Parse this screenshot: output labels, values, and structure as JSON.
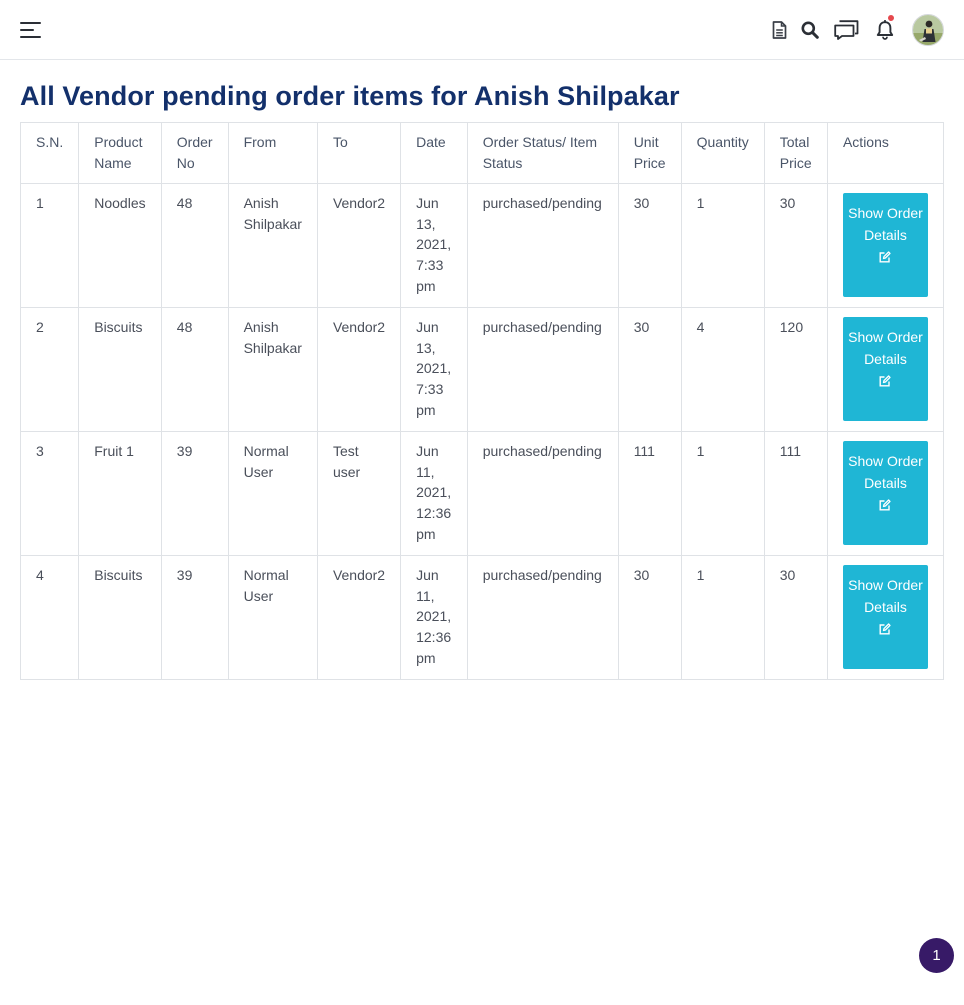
{
  "header": {
    "icons": [
      "menu-icon",
      "document-icon",
      "search-icon",
      "chat-icon",
      "bell-icon",
      "avatar"
    ]
  },
  "page": {
    "title": "All Vendor pending order items for Anish Shilpakar"
  },
  "table": {
    "headers": [
      "S.N.",
      "Product Name",
      "Order No",
      "From",
      "To",
      "Date",
      "Order Status/ Item Status",
      "Unit Price",
      "Quantity",
      "Total Price",
      "Actions"
    ],
    "rows": [
      {
        "sn": "1",
        "product": "Noodles",
        "order_no": "48",
        "from": "Anish Shilpakar",
        "to": "Vendor2",
        "date": "Jun 13, 2021, 7:33 pm",
        "status": "purchased/pending",
        "unit_price": "30",
        "quantity": "1",
        "total_price": "30",
        "action_label": "Show Order Details"
      },
      {
        "sn": "2",
        "product": "Biscuits",
        "order_no": "48",
        "from": "Anish Shilpakar",
        "to": "Vendor2",
        "date": "Jun 13, 2021, 7:33 pm",
        "status": "purchased/pending",
        "unit_price": "30",
        "quantity": "4",
        "total_price": "120",
        "action_label": "Show Order Details"
      },
      {
        "sn": "3",
        "product": "Fruit 1",
        "order_no": "39",
        "from": "Normal User",
        "to": "Test user",
        "date": "Jun 11, 2021, 12:36 pm",
        "status": "purchased/pending",
        "unit_price": "111",
        "quantity": "1",
        "total_price": "111",
        "action_label": "Show Order Details"
      },
      {
        "sn": "4",
        "product": "Biscuits",
        "order_no": "39",
        "from": "Normal User",
        "to": "Vendor2",
        "date": "Jun 11, 2021, 12:36 pm",
        "status": "purchased/pending",
        "unit_price": "30",
        "quantity": "1",
        "total_price": "30",
        "action_label": "Show Order Details"
      }
    ]
  },
  "pagination": {
    "current_page": "1"
  },
  "colors": {
    "title": "#13306b",
    "action_button": "#1fb6d5",
    "page_badge": "#371a67",
    "notification_dot": "#e5484d"
  }
}
